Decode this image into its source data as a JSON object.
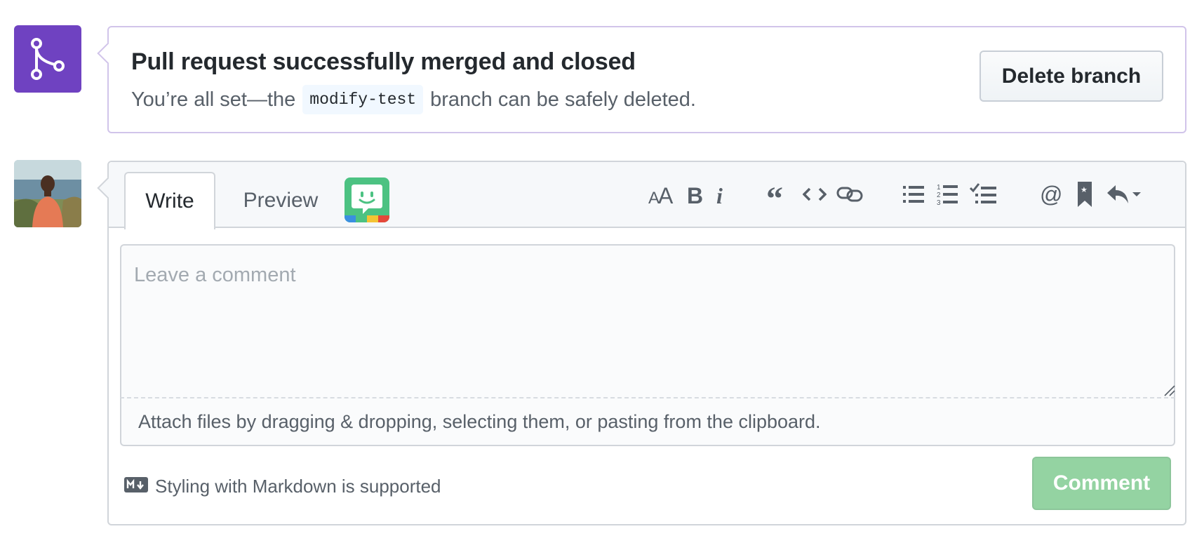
{
  "merged": {
    "title": "Pull request successfully merged and closed",
    "desc_prefix": "You’re all set—the",
    "branch_name": "modify-test",
    "desc_suffix": "branch can be safely deleted.",
    "delete_button": "Delete branch",
    "badge_icon": "git-merge-icon",
    "badge_color": "#6f42c1"
  },
  "comment": {
    "tabs": [
      {
        "label": "Write",
        "active": true
      },
      {
        "label": "Preview",
        "active": false
      }
    ],
    "toolbar": [
      "text-size-icon",
      "bold-icon",
      "italic-icon",
      "quote-icon",
      "code-icon",
      "link-icon",
      "bulleted-list-icon",
      "numbered-list-icon",
      "task-list-icon",
      "mention-icon",
      "saved-replies-bookmark-icon",
      "reply-icon"
    ],
    "placeholder": "Leave a comment",
    "attach_hint": "Attach files by dragging & dropping, selecting them, or pasting from the clipboard.",
    "markdown_note": "Styling with Markdown is supported",
    "submit_label": "Comment",
    "submit_color": "#94d3a2"
  }
}
